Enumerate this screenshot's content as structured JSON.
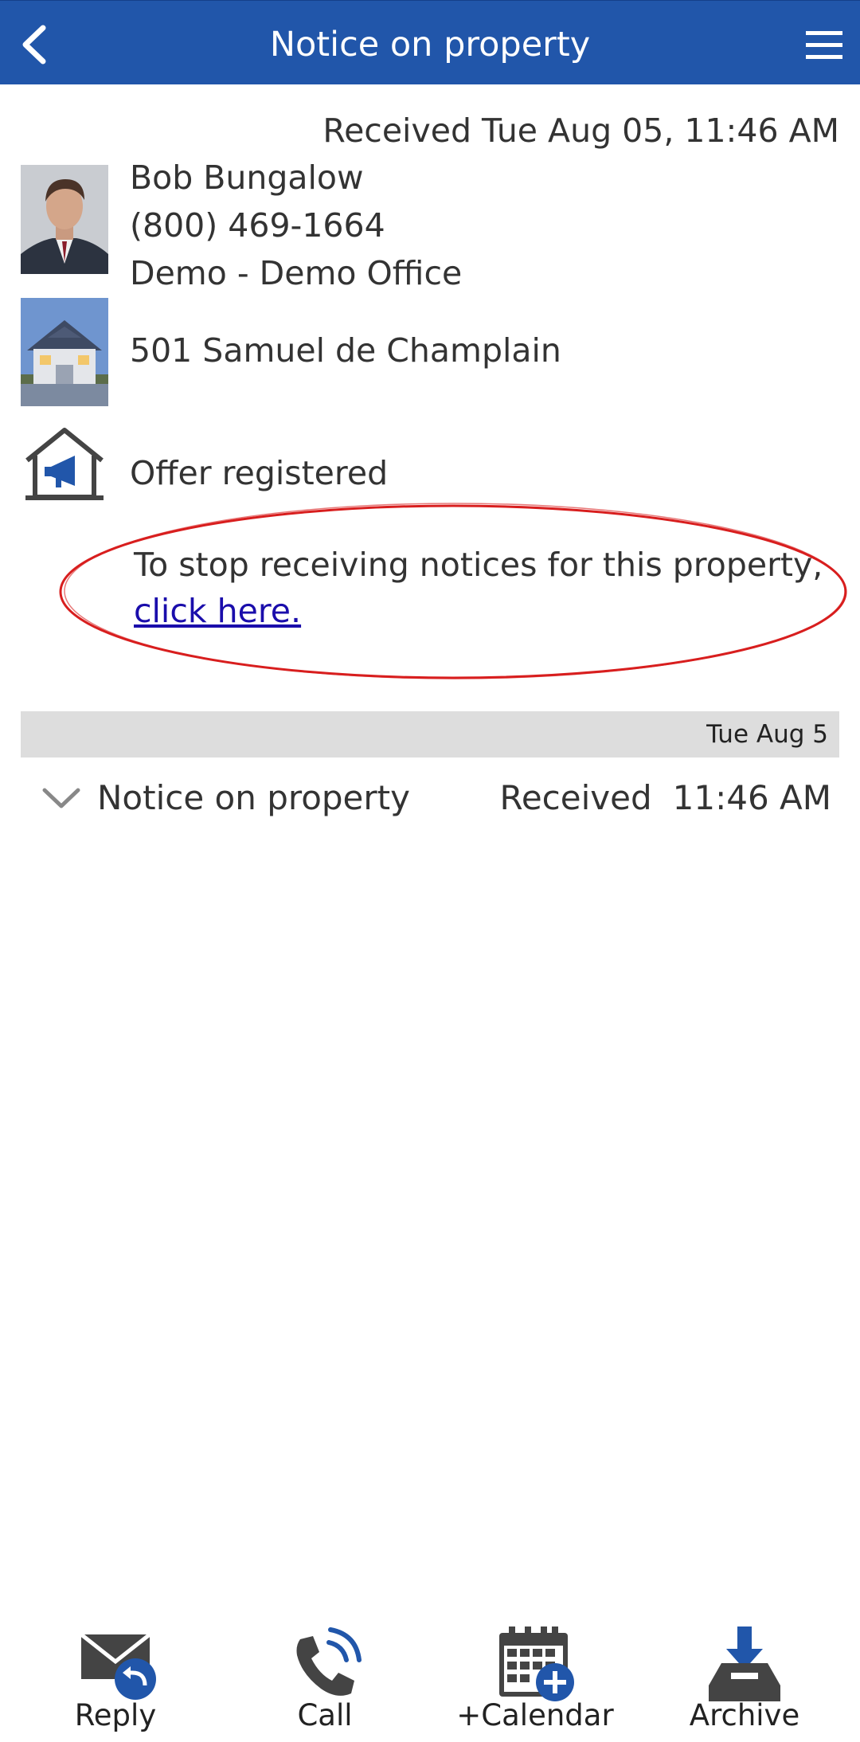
{
  "header": {
    "title": "Notice on property",
    "back_icon": "chevron-left-icon",
    "menu_icon": "hamburger-menu-icon",
    "color": "#2156aa"
  },
  "message": {
    "received": "Received Tue Aug 05, 11:46 AM",
    "agent": {
      "name": "Bob Bungalow",
      "phone": "(800) 469-1664",
      "office": "Demo - Demo Office"
    },
    "property": {
      "address": "501 Samuel de Champlain"
    },
    "event": {
      "label": "Offer registered",
      "icon": "house-megaphone-icon"
    },
    "unsubscribe": {
      "text": "To stop receiving notices for this property,",
      "link": "click here."
    },
    "highlight_color": "#d81e1e"
  },
  "thread": {
    "date_label": "Tue Aug 5",
    "items": [
      {
        "title": "Notice on property",
        "received_label": "Received",
        "time": "11:46 AM"
      }
    ]
  },
  "toolbar": {
    "reply": "Reply",
    "call": "Call",
    "calendar": "+Calendar",
    "archive": "Archive"
  }
}
